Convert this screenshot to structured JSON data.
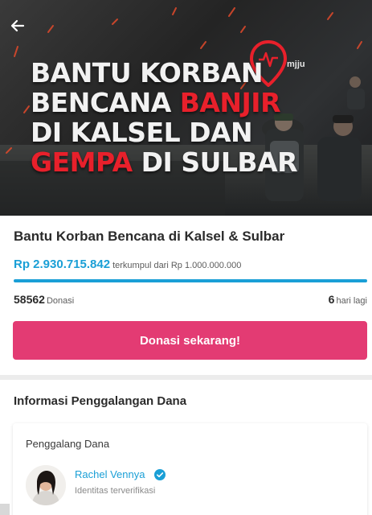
{
  "banner": {
    "headline_line1": "BANTU KORBAN",
    "headline_line2_a": "BENCANA ",
    "headline_line2_b": "BANJIR",
    "headline_line3": "DI KALSEL DAN",
    "headline_line4_a": "GEMPA",
    "headline_line4_b": " DI SULBAR",
    "logo_text": "mjju",
    "accent_color": "#e8202b"
  },
  "campaign": {
    "title": "Bantu Korban Bencana di Kalsel & Sulbar",
    "amount": "Rp 2.930.715.842",
    "amount_meta": "terkumpul dari Rp 1.000.000.000",
    "progress_percent": 100,
    "donations_count": "58562",
    "donations_label": "Donasi",
    "days_left": "6",
    "days_label": "hari lagi",
    "cta_label": "Donasi sekarang!",
    "cta_color": "#e33b73",
    "accent_color": "#1a9fd6"
  },
  "info": {
    "section_title": "Informasi Penggalangan Dana",
    "fundraiser_label": "Penggalang Dana",
    "fundraiser_name": "Rachel Vennya",
    "verified_text": "Identitas terverifikasi"
  },
  "icons": {
    "back": "arrow-left-icon",
    "verified": "verified-check-icon"
  }
}
